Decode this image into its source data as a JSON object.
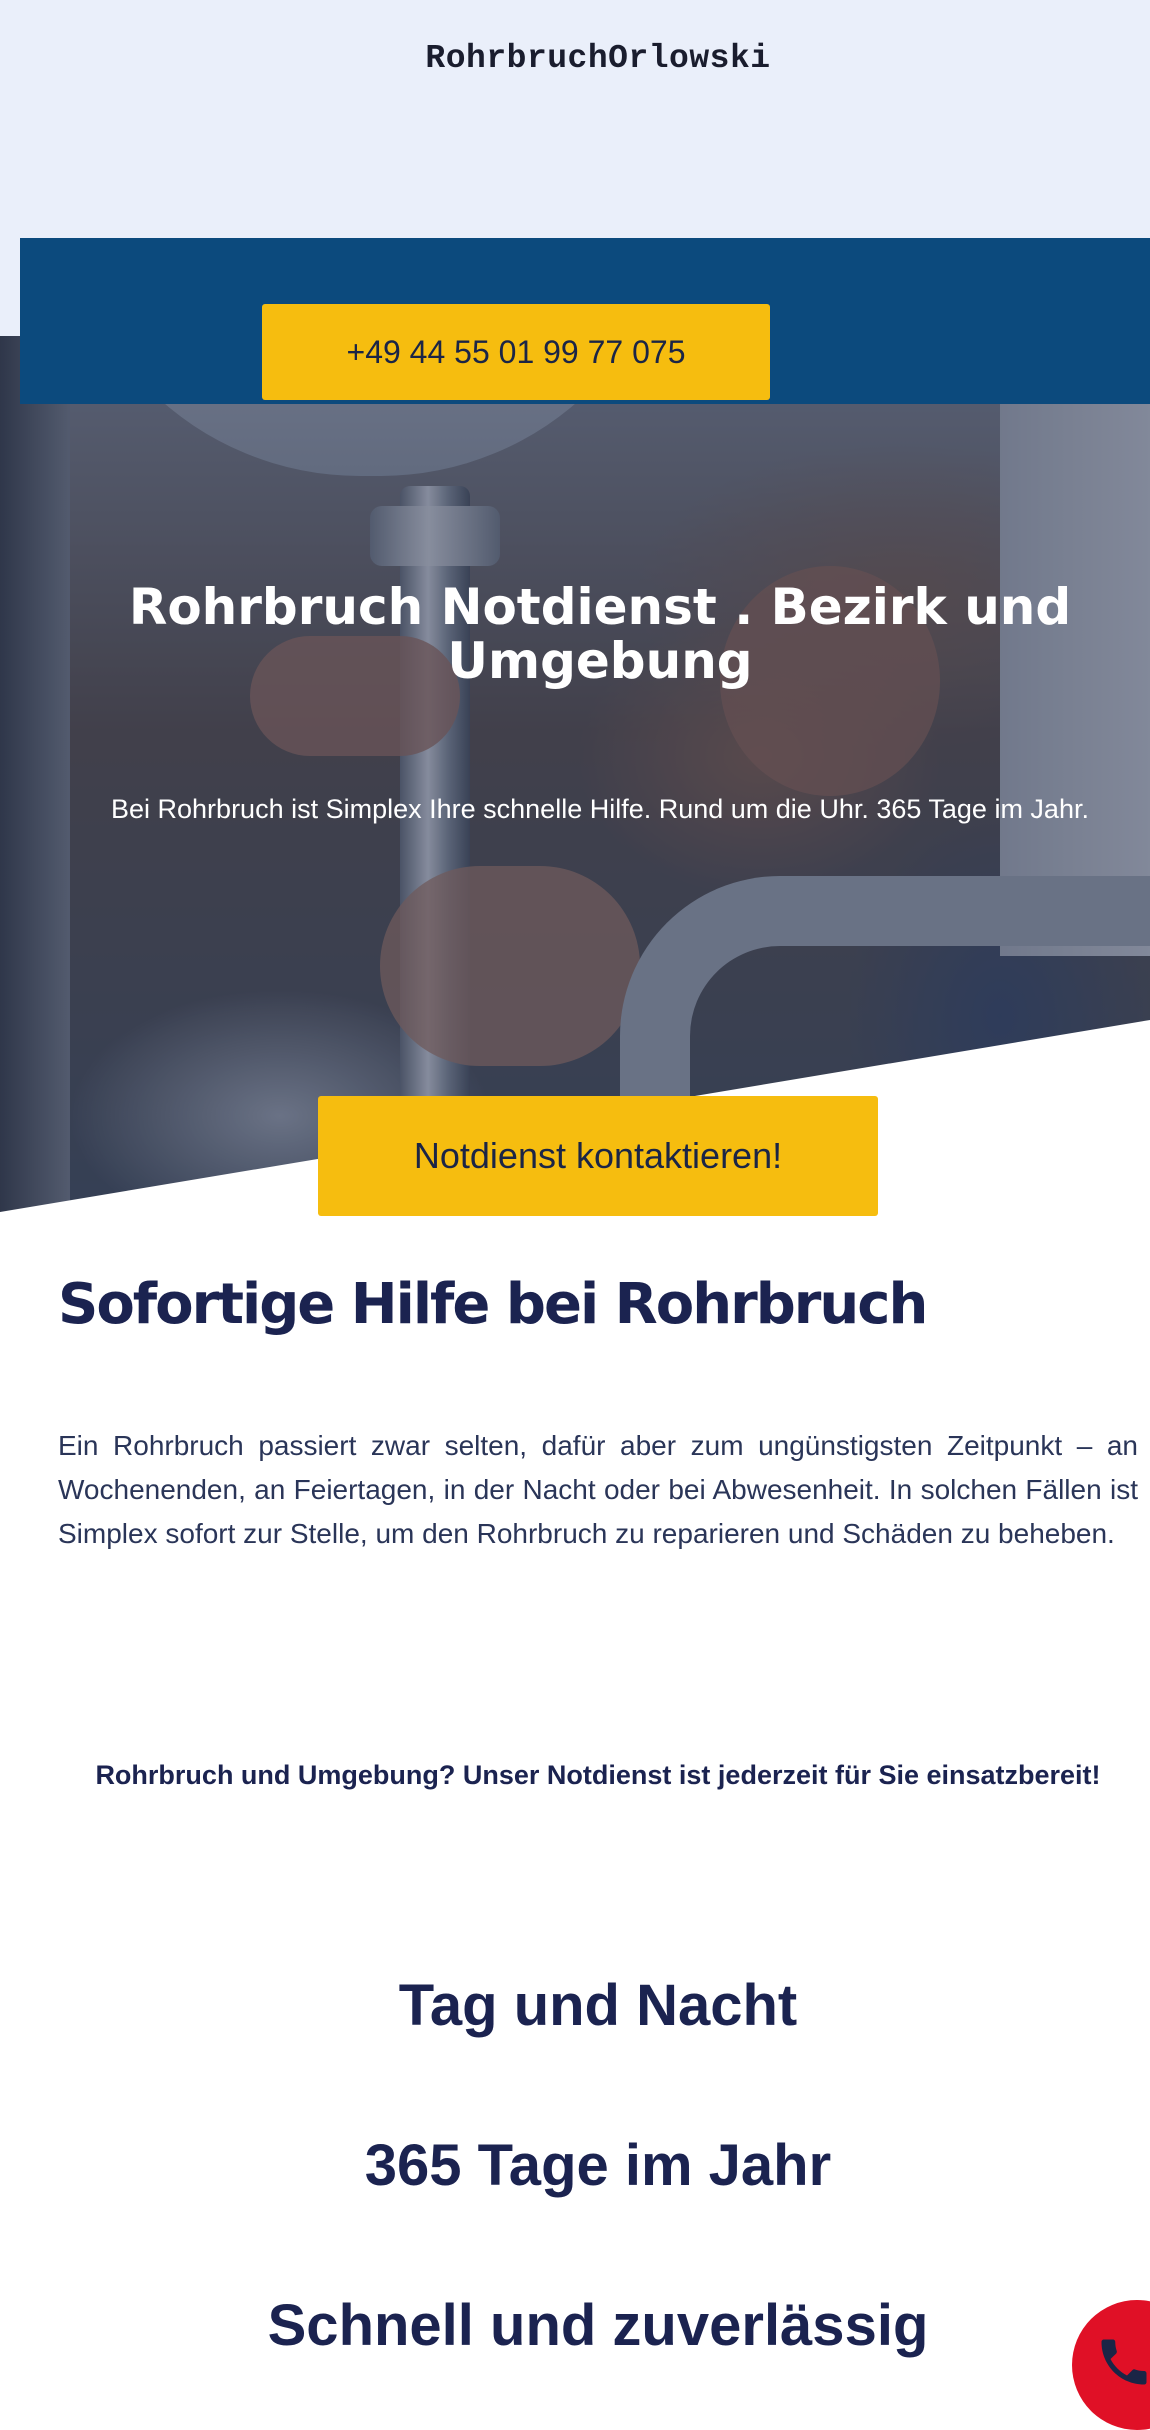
{
  "header": {
    "logo_text": "RohrbruchOrlowski"
  },
  "phone_bar": {
    "phone_label": "+49 44 55 01 99 77 075"
  },
  "hero": {
    "title": "Rohrbruch Notdienst . Bezirk und Umgebung",
    "subtitle": "Bei Rohrbruch ist Simplex Ihre schnelle Hilfe. Rund um die Uhr. 365 Tage im Jahr.",
    "cta_label": "Notdienst kontaktieren!"
  },
  "content": {
    "section_title": "Sofortige Hilfe bei Rohrbruch",
    "body": "Ein Rohrbruch passiert zwar selten, dafür aber zum ungünstigsten Zeitpunkt – an Wochenenden, an Feiertagen, in der Nacht oder bei Abwesenheit. In solchen Fällen ist Simplex sofort zur Stelle, um den Rohrbruch zu reparieren und Schäden zu beheben.",
    "tagline": "Rohrbruch und Umgebung? Unser Notdienst ist jederzeit für Sie einsatzbereit!"
  },
  "features": [
    {
      "label": "Tag und Nacht"
    },
    {
      "label": "365 Tage im Jahr"
    },
    {
      "label": "Schnell und zuverlässig"
    }
  ],
  "floating": {
    "icon": "phone-icon",
    "color": "#e01026"
  },
  "colors": {
    "accent_yellow": "#f6bd0f",
    "bar_blue": "#0c4a7d",
    "text_navy": "#1b2350",
    "top_background": "#eaeffa"
  }
}
